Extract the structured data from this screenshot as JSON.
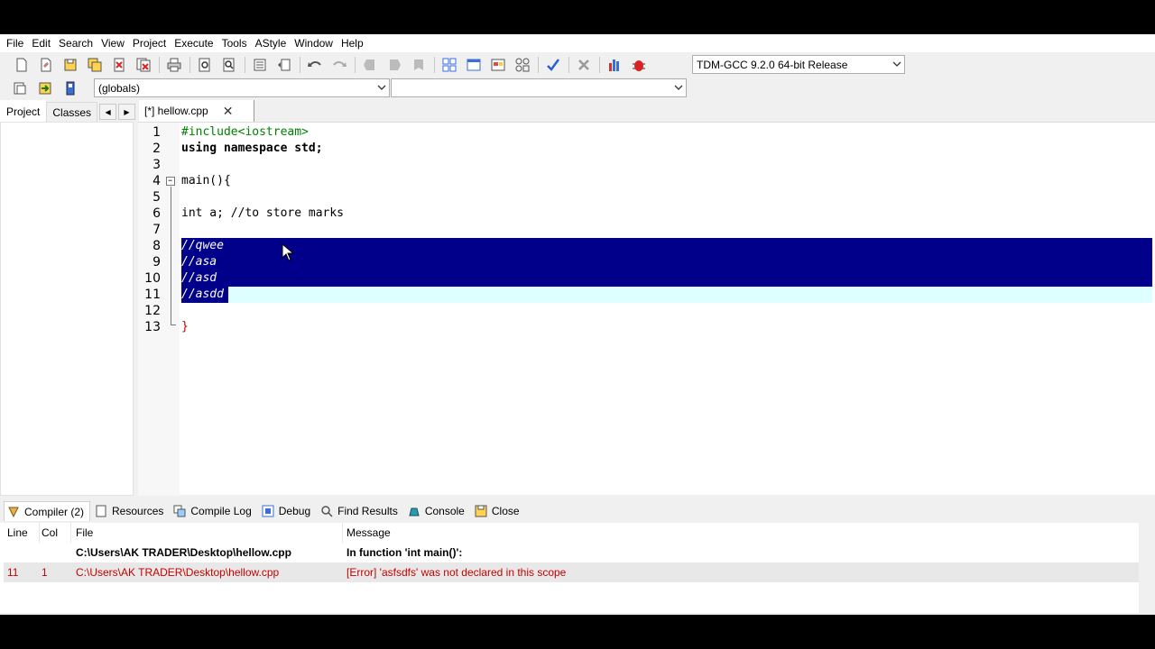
{
  "menu": [
    "File",
    "Edit",
    "Search",
    "View",
    "Project",
    "Execute",
    "Tools",
    "AStyle",
    "Window",
    "Help"
  ],
  "toolbar": {
    "compiler_select": "TDM-GCC 9.2.0 64-bit Release",
    "scope_select": "(globals)",
    "function_select": ""
  },
  "left_panel": {
    "tabs": [
      "Project",
      "Classes"
    ],
    "nav_prev": "◀",
    "nav_next": "▶"
  },
  "editor": {
    "tab_label": "[*] hellow.cpp",
    "tab_close": "✕",
    "lines": [
      {
        "n": "1",
        "text": "#include<iostream>"
      },
      {
        "n": "2",
        "text": "using namespace std;"
      },
      {
        "n": "3",
        "text": ""
      },
      {
        "n": "4",
        "text": "main(){"
      },
      {
        "n": "5",
        "text": ""
      },
      {
        "n": "6",
        "text": "int a; //to store marks"
      },
      {
        "n": "7",
        "text": ""
      },
      {
        "n": "8",
        "text": "//qwee"
      },
      {
        "n": "9",
        "text": "//asa"
      },
      {
        "n": "10",
        "text": "//asd"
      },
      {
        "n": "11",
        "text": "//asdd"
      },
      {
        "n": "12",
        "text": ""
      },
      {
        "n": "13",
        "text": "}"
      }
    ]
  },
  "bottom_tabs": [
    "Compiler (2)",
    "Resources",
    "Compile Log",
    "Debug",
    "Find Results",
    "Console",
    "Close"
  ],
  "messages": {
    "headers": {
      "line": "Line",
      "col": "Col",
      "file": "File",
      "message": "Message"
    },
    "rows": [
      {
        "line": "",
        "col": "",
        "file": "C:\\Users\\AK TRADER\\Desktop\\hellow.cpp",
        "message": "In function 'int main()':",
        "type": "info"
      },
      {
        "line": "11",
        "col": "1",
        "file": "C:\\Users\\AK TRADER\\Desktop\\hellow.cpp",
        "message": "[Error] 'asfsdfs' was not declared in this scope",
        "type": "error"
      }
    ]
  },
  "colors": {
    "selection": "#00008a",
    "current_line": "#ddffff",
    "error_text": "#c80000",
    "comment": "#0b3bd4"
  }
}
